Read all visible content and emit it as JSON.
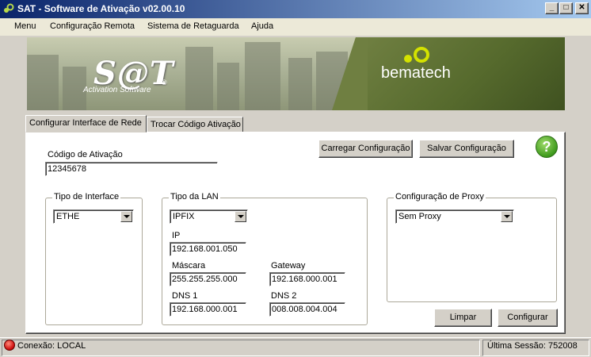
{
  "window": {
    "title": "SAT - Software de Ativação v02.00.10",
    "min_glyph": "_",
    "max_glyph": "□",
    "close_glyph": "✕"
  },
  "menu": {
    "items": [
      "Menu",
      "Configuração Remota",
      "Sistema de Retaguarda",
      "Ajuda"
    ]
  },
  "banner": {
    "logo": "S@T",
    "subtitle": "Activation Software",
    "reg_mark": "®",
    "brand": "bematech"
  },
  "tabs": [
    {
      "label": "Configurar Interface de Rede",
      "active": true
    },
    {
      "label": "Trocar Código Ativação",
      "active": false
    }
  ],
  "activation": {
    "label": "Código de Ativação",
    "value": "12345678"
  },
  "buttons": {
    "load": "Carregar Configuração",
    "save": "Salvar Configuração",
    "help": "?",
    "clear": "Limpar",
    "configure": "Configurar"
  },
  "interface_type": {
    "title": "Tipo de Interface",
    "selected": "ETHE"
  },
  "lan": {
    "title": "Tipo da LAN",
    "selected": "IPFIX",
    "ip_label": "IP",
    "ip": "192.168.001.050",
    "mask_label": "Máscara",
    "mask": "255.255.255.000",
    "gateway_label": "Gateway",
    "gateway": "192.168.000.001",
    "dns1_label": "DNS 1",
    "dns1": "192.168.000.001",
    "dns2_label": "DNS 2",
    "dns2": "008.008.004.004"
  },
  "proxy": {
    "title": "Configuração de Proxy",
    "selected": "Sem Proxy"
  },
  "status": {
    "connection": "Conexão: LOCAL",
    "last_session": "Última Sessão: 752008",
    "connection_color": "#d01010"
  }
}
